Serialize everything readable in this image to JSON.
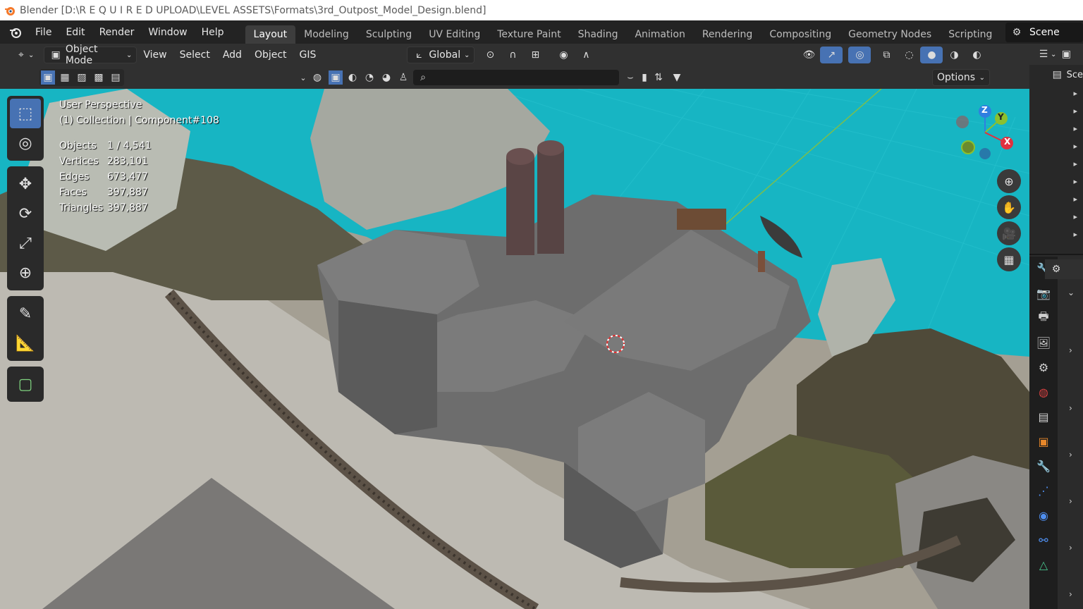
{
  "window": {
    "title": "Blender [D:\\R E Q U I R E D   UPLOAD\\LEVEL ASSETS\\Formats\\3rd_Outpost_Model_Design.blend]"
  },
  "menu": {
    "items": [
      "File",
      "Edit",
      "Render",
      "Window",
      "Help"
    ]
  },
  "workspaces": {
    "tabs": [
      "Layout",
      "Modeling",
      "Sculpting",
      "UV Editing",
      "Texture Paint",
      "Shading",
      "Animation",
      "Rendering",
      "Compositing",
      "Geometry Nodes",
      "Scripting"
    ],
    "active": "Layout",
    "add_symbol": "+"
  },
  "scene": {
    "label": "Scene"
  },
  "viewport_header": {
    "mode": "Object Mode",
    "menus": [
      "View",
      "Select",
      "Add",
      "Object",
      "GIS"
    ],
    "transform_orientation": "Global"
  },
  "tool_settings": {
    "options_label": "Options",
    "search_placeholder": ""
  },
  "overlay": {
    "view_name": "User Perspective",
    "collection": "(1) Collection | Component#108",
    "stats": [
      {
        "key": "Objects",
        "value": "1 / 4,541"
      },
      {
        "key": "Vertices",
        "value": "283,101"
      },
      {
        "key": "Edges",
        "value": "673,477"
      },
      {
        "key": "Faces",
        "value": "397,887"
      },
      {
        "key": "Triangles",
        "value": "397,887"
      }
    ]
  },
  "gizmo": {
    "x": "X",
    "y": "Y",
    "z": "Z"
  },
  "outliner": {
    "label": "Sce"
  },
  "colors": {
    "sky": "#17b5c3",
    "accent": "#4772b3",
    "axis_x": "#e0313f",
    "axis_y": "#8bc02f",
    "axis_z": "#2f7fe0"
  }
}
